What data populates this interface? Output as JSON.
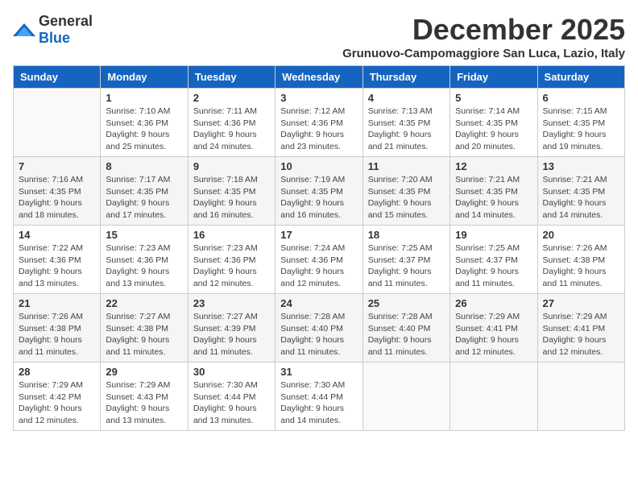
{
  "header": {
    "logo_general": "General",
    "logo_blue": "Blue",
    "month_title": "December 2025",
    "subtitle": "Grunuovo-Campomaggiore San Luca, Lazio, Italy"
  },
  "days_of_week": [
    "Sunday",
    "Monday",
    "Tuesday",
    "Wednesday",
    "Thursday",
    "Friday",
    "Saturday"
  ],
  "weeks": [
    [
      {
        "day": "",
        "info": ""
      },
      {
        "day": "1",
        "info": "Sunrise: 7:10 AM\nSunset: 4:36 PM\nDaylight: 9 hours\nand 25 minutes."
      },
      {
        "day": "2",
        "info": "Sunrise: 7:11 AM\nSunset: 4:36 PM\nDaylight: 9 hours\nand 24 minutes."
      },
      {
        "day": "3",
        "info": "Sunrise: 7:12 AM\nSunset: 4:36 PM\nDaylight: 9 hours\nand 23 minutes."
      },
      {
        "day": "4",
        "info": "Sunrise: 7:13 AM\nSunset: 4:35 PM\nDaylight: 9 hours\nand 21 minutes."
      },
      {
        "day": "5",
        "info": "Sunrise: 7:14 AM\nSunset: 4:35 PM\nDaylight: 9 hours\nand 20 minutes."
      },
      {
        "day": "6",
        "info": "Sunrise: 7:15 AM\nSunset: 4:35 PM\nDaylight: 9 hours\nand 19 minutes."
      }
    ],
    [
      {
        "day": "7",
        "info": "Sunrise: 7:16 AM\nSunset: 4:35 PM\nDaylight: 9 hours\nand 18 minutes."
      },
      {
        "day": "8",
        "info": "Sunrise: 7:17 AM\nSunset: 4:35 PM\nDaylight: 9 hours\nand 17 minutes."
      },
      {
        "day": "9",
        "info": "Sunrise: 7:18 AM\nSunset: 4:35 PM\nDaylight: 9 hours\nand 16 minutes."
      },
      {
        "day": "10",
        "info": "Sunrise: 7:19 AM\nSunset: 4:35 PM\nDaylight: 9 hours\nand 16 minutes."
      },
      {
        "day": "11",
        "info": "Sunrise: 7:20 AM\nSunset: 4:35 PM\nDaylight: 9 hours\nand 15 minutes."
      },
      {
        "day": "12",
        "info": "Sunrise: 7:21 AM\nSunset: 4:35 PM\nDaylight: 9 hours\nand 14 minutes."
      },
      {
        "day": "13",
        "info": "Sunrise: 7:21 AM\nSunset: 4:35 PM\nDaylight: 9 hours\nand 14 minutes."
      }
    ],
    [
      {
        "day": "14",
        "info": "Sunrise: 7:22 AM\nSunset: 4:36 PM\nDaylight: 9 hours\nand 13 minutes."
      },
      {
        "day": "15",
        "info": "Sunrise: 7:23 AM\nSunset: 4:36 PM\nDaylight: 9 hours\nand 13 minutes."
      },
      {
        "day": "16",
        "info": "Sunrise: 7:23 AM\nSunset: 4:36 PM\nDaylight: 9 hours\nand 12 minutes."
      },
      {
        "day": "17",
        "info": "Sunrise: 7:24 AM\nSunset: 4:36 PM\nDaylight: 9 hours\nand 12 minutes."
      },
      {
        "day": "18",
        "info": "Sunrise: 7:25 AM\nSunset: 4:37 PM\nDaylight: 9 hours\nand 11 minutes."
      },
      {
        "day": "19",
        "info": "Sunrise: 7:25 AM\nSunset: 4:37 PM\nDaylight: 9 hours\nand 11 minutes."
      },
      {
        "day": "20",
        "info": "Sunrise: 7:26 AM\nSunset: 4:38 PM\nDaylight: 9 hours\nand 11 minutes."
      }
    ],
    [
      {
        "day": "21",
        "info": "Sunrise: 7:26 AM\nSunset: 4:38 PM\nDaylight: 9 hours\nand 11 minutes."
      },
      {
        "day": "22",
        "info": "Sunrise: 7:27 AM\nSunset: 4:38 PM\nDaylight: 9 hours\nand 11 minutes."
      },
      {
        "day": "23",
        "info": "Sunrise: 7:27 AM\nSunset: 4:39 PM\nDaylight: 9 hours\nand 11 minutes."
      },
      {
        "day": "24",
        "info": "Sunrise: 7:28 AM\nSunset: 4:40 PM\nDaylight: 9 hours\nand 11 minutes."
      },
      {
        "day": "25",
        "info": "Sunrise: 7:28 AM\nSunset: 4:40 PM\nDaylight: 9 hours\nand 11 minutes."
      },
      {
        "day": "26",
        "info": "Sunrise: 7:29 AM\nSunset: 4:41 PM\nDaylight: 9 hours\nand 12 minutes."
      },
      {
        "day": "27",
        "info": "Sunrise: 7:29 AM\nSunset: 4:41 PM\nDaylight: 9 hours\nand 12 minutes."
      }
    ],
    [
      {
        "day": "28",
        "info": "Sunrise: 7:29 AM\nSunset: 4:42 PM\nDaylight: 9 hours\nand 12 minutes."
      },
      {
        "day": "29",
        "info": "Sunrise: 7:29 AM\nSunset: 4:43 PM\nDaylight: 9 hours\nand 13 minutes."
      },
      {
        "day": "30",
        "info": "Sunrise: 7:30 AM\nSunset: 4:44 PM\nDaylight: 9 hours\nand 13 minutes."
      },
      {
        "day": "31",
        "info": "Sunrise: 7:30 AM\nSunset: 4:44 PM\nDaylight: 9 hours\nand 14 minutes."
      },
      {
        "day": "",
        "info": ""
      },
      {
        "day": "",
        "info": ""
      },
      {
        "day": "",
        "info": ""
      }
    ]
  ]
}
